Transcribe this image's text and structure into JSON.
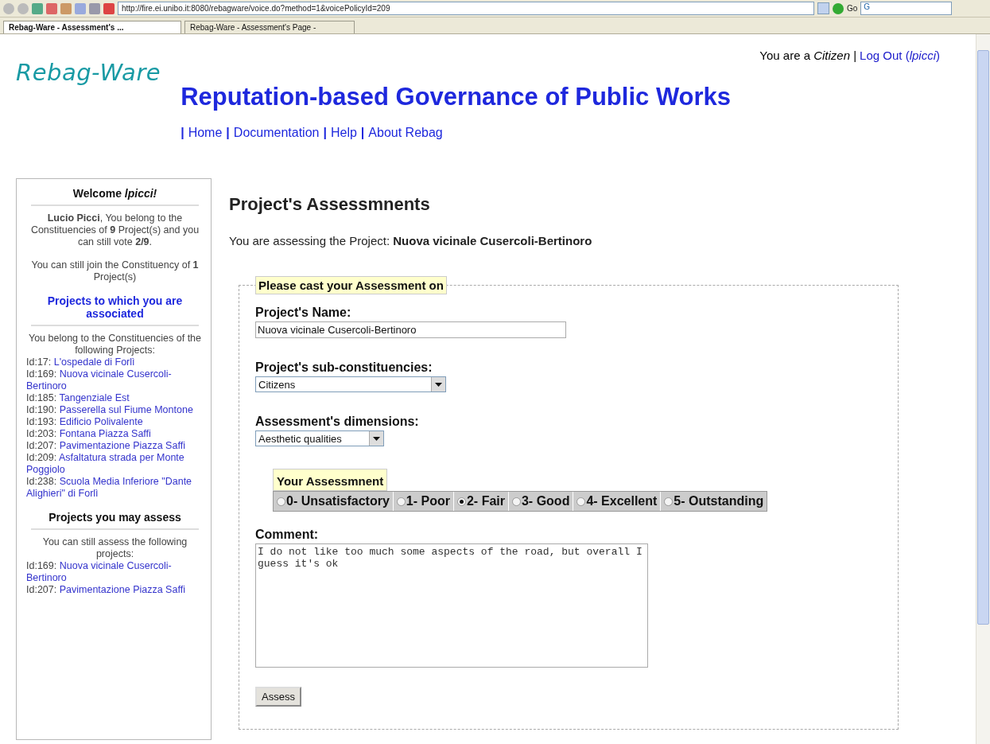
{
  "browser": {
    "address": "http://fire.ei.unibo.it:8080/rebagware/voice.do?method=1&voicePolicyId=209",
    "go_label": "Go",
    "search_value": "G",
    "tabs": [
      {
        "label": "Rebag-Ware - Assessment's ...",
        "selected": true
      },
      {
        "label": "Rebag-Ware - Assessment's Page -",
        "selected": false
      }
    ]
  },
  "header": {
    "status": "You are a *Citizen* |",
    "logout": "Log Out (*lpicci*)",
    "logo": "Rebag-Ware",
    "title": "Reputation-based Governance of Public Works",
    "nav_separator": "|",
    "nav": [
      "Home",
      "Documentation",
      "Help",
      "About Rebag"
    ]
  },
  "sidebar": {
    "welcome": "Welcome *lpicci!*",
    "intro": "**Lucio Picci**, You belong to the Constituencies of **9** Project(s) and you can still vote **2/9**.",
    "join": "You can still join the Constituency of **1** Project(s)",
    "associated_title": "Projects to which you are associated",
    "associated_intro": "You belong to the Constituencies of the following Projects:",
    "associated": [
      {
        "id": "Id:17:",
        "name": "L'ospedale di Forlì"
      },
      {
        "id": "Id:169:",
        "name": "Nuova vicinale Cusercoli-Bertinoro"
      },
      {
        "id": "Id:185:",
        "name": "Tangenziale Est"
      },
      {
        "id": "Id:190:",
        "name": "Passerella sul Fiume Montone"
      },
      {
        "id": "Id:193:",
        "name": "Edificio Polivalente"
      },
      {
        "id": "Id:203:",
        "name": "Fontana Piazza Saffi"
      },
      {
        "id": "Id:207:",
        "name": "Pavimentazione Piazza Saffi"
      },
      {
        "id": "Id:209:",
        "name": "Asfaltatura strada per Monte Poggiolo"
      },
      {
        "id": "Id:238:",
        "name": "Scuola Media Inferiore \"Dante Alighieri\" di Forlì"
      }
    ],
    "assess_title": "Projects you may assess",
    "assess_intro": "You can still assess the following projects:",
    "assessable": [
      {
        "id": "Id:169:",
        "name": "Nuova vicinale Cusercoli-Bertinoro"
      },
      {
        "id": "Id:207:",
        "name": "Pavimentazione Piazza Saffi"
      }
    ]
  },
  "main": {
    "heading": "Project's Assessmnents",
    "assessing": "You are assessing the Project: **Nuova vicinale Cusercoli-Bertinoro**",
    "form": {
      "legend": "Please cast your Assessment on",
      "name_label": "Project's Name:",
      "name_value": "Nuova vicinale Cusercoli-Bertinoro",
      "sub_label": "Project's sub-constituencies:",
      "sub_value": "Citizens",
      "dim_label": "Assessment's dimensions:",
      "dim_value": "Aesthetic qualities",
      "rating_legend": "Your Assessmnent",
      "ratings": [
        {
          "label": "0- Unsatisfactory",
          "selected": false
        },
        {
          "label": "1- Poor",
          "selected": false
        },
        {
          "label": "2- Fair",
          "selected": true
        },
        {
          "label": "3- Good",
          "selected": false
        },
        {
          "label": "4- Excellent",
          "selected": false
        },
        {
          "label": "5- Outstanding",
          "selected": false
        }
      ],
      "comment_label": "Comment:",
      "comment_value": "I do not like too much some aspects of the road, but overall I guess it's ok",
      "submit": "Assess"
    }
  }
}
